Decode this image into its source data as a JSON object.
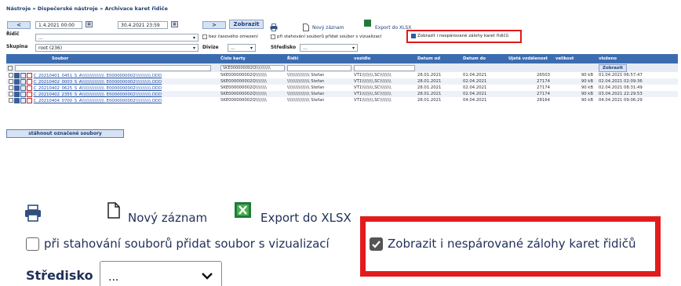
{
  "breadcrumb": "Nástroje » Dispečerské nástroje » Archivace karet řidiče",
  "filters": {
    "prev_label": "<",
    "date_from": "1.4.2021 00:00",
    "date_to": "30.4.2021 23:59",
    "next_label": ">",
    "show_label": "Zobrazit",
    "new_record_label": "Nový záznam",
    "export_label": "Export do XLSX",
    "driver_label": "Řidič",
    "driver_value": "...",
    "no_time_limit_label": "bez časového omezení",
    "add_viz_label": "při stahování souborů přidat soubor s vizualizací",
    "show_unpaired_label": "Zobrazit i nespárované zálohy karet řidičů",
    "group_label": "Skupina",
    "group_value": "root (236)",
    "division_label": "Divize",
    "division_value": "...",
    "center_label": "Středisko",
    "center_value": "..."
  },
  "table": {
    "headers": [
      "Soubor",
      "Číslo karty",
      "Řidič",
      "vozidlo",
      "Datum od",
      "Datum do",
      "Ujetá vzdálenost",
      "velikost",
      "vloženo"
    ],
    "filter_card_value": "SKE000000002Q\\\\\\\\\\\\\\\\\\\\\\",
    "filter_button": "Zobrazit",
    "rows": [
      {
        "file": "C_20210401_0451_S_A\\\\\\\\\\\\\\\\\\\\\\\\\\\\\\\\_E0000000002\\\\\\\\\\\\\\\\\\\\\\.DDD",
        "card": "SKE000000002Q\\\\\\\\\\\\\\\\",
        "driver": "\\\\\\\\\\\\\\\\\\\\\\\\\\\\\\\\ Stefan",
        "vehicle": "VT1\\\\\\\\\\\\\\\\,SC\\\\\\\\\\\\\\\\",
        "from": "28.01.2021",
        "to": "01.04.2021",
        "distance": "26503",
        "size": "90 kB",
        "inserted": "01.04.2021 06:57:47"
      },
      {
        "file": "C_20210402_0003_S_A\\\\\\\\\\\\\\\\\\\\\\\\\\\\\\\\_E0000000002\\\\\\\\\\\\\\\\\\\\\\.DDD",
        "card": "SKE000000002Q\\\\\\\\\\\\\\\\",
        "driver": "\\\\\\\\\\\\\\\\\\\\\\\\\\\\\\\\ Stefan",
        "vehicle": "VT1\\\\\\\\\\\\\\\\,SC\\\\\\\\\\\\\\\\",
        "from": "28.01.2021",
        "to": "02.04.2021",
        "distance": "27174",
        "size": "90 kB",
        "inserted": "02.04.2021 02:09:36"
      },
      {
        "file": "C_20210402_0625_S_A\\\\\\\\\\\\\\\\\\\\\\\\\\\\\\\\_E0000000002\\\\\\\\\\\\\\\\\\\\\\.DDD",
        "card": "SKE000000002Q\\\\\\\\\\\\\\\\",
        "driver": "\\\\\\\\\\\\\\\\\\\\\\\\\\\\\\\\ Stefan",
        "vehicle": "VT1\\\\\\\\\\\\\\\\,SC\\\\\\\\\\\\\\\\",
        "from": "28.01.2021",
        "to": "02.04.2021",
        "distance": "27174",
        "size": "90 kB",
        "inserted": "02.04.2021 08:31:49"
      },
      {
        "file": "C_20210402_2355_S_A\\\\\\\\\\\\\\\\\\\\\\\\\\\\\\\\_E0000000002\\\\\\\\\\\\\\\\\\\\\\.DDD",
        "card": "SKE000000002Q\\\\\\\\\\\\\\\\",
        "driver": "\\\\\\\\\\\\\\\\\\\\\\\\\\\\\\\\ Stefan",
        "vehicle": "VT1\\\\\\\\\\\\\\\\,SC\\\\\\\\\\\\\\\\",
        "from": "28.01.2021",
        "to": "02.04.2021",
        "distance": "27174",
        "size": "90 kB",
        "inserted": "03.04.2021 22:29:53"
      },
      {
        "file": "C_20210404_0700_S_A\\\\\\\\\\\\\\\\\\\\\\\\\\\\\\\\_E0000000002\\\\\\\\\\\\\\\\\\\\\\.DDD",
        "card": "SKE000000002Q\\\\\\\\\\\\\\\\",
        "driver": "\\\\\\\\\\\\\\\\\\\\\\\\\\\\\\\\ Stefan",
        "vehicle": "VT1\\\\\\\\\\\\\\\\,SC\\\\\\\\\\\\\\\\",
        "from": "28.01.2021",
        "to": "04.04.2021",
        "distance": "28164",
        "size": "90 kB",
        "inserted": "04.04.2021 09:06:29"
      }
    ]
  },
  "download_button": "stáhnout označené soubory",
  "zoom": {
    "new_record_label": "Nový záznam",
    "export_label": "Export do XLSX",
    "add_viz_label": "při stahování souborů přidat soubor s vizualizací",
    "show_unpaired_label": "Zobrazit i nespárované zálohy karet řidičů",
    "center_label": "Středisko",
    "center_value": "..."
  },
  "colors": {
    "highlight": "#e21c1c",
    "header_bg": "#3c6cb0",
    "link": "#2350a8",
    "excel_green": "#1f7a3a"
  },
  "icons": [
    "print-icon",
    "new-document-icon",
    "excel-icon",
    "calendar-icon",
    "chevron-down-icon",
    "folder-icon",
    "pdf-icon"
  ]
}
